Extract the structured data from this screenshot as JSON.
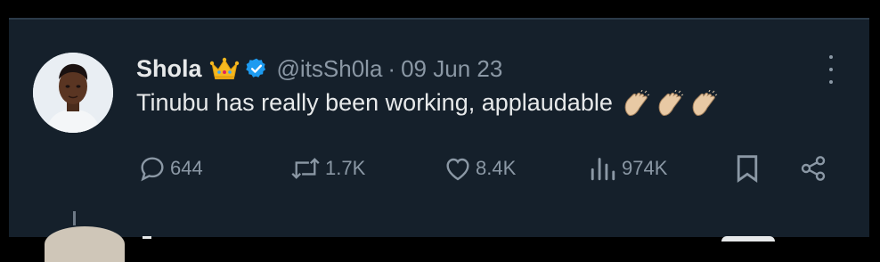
{
  "post": {
    "author_name": "Shola",
    "handle": "@itsSh0la",
    "separator": "·",
    "date": "09 Jun 23",
    "text": "Tinubu has really been working, applaudable"
  },
  "icons": {
    "crown": "crown-emoji",
    "verified": "verified-badge-icon",
    "claps": [
      "clapping-hands-emoji",
      "clapping-hands-emoji",
      "clapping-hands-emoji"
    ],
    "more": "more-options-icon"
  },
  "actions": {
    "replies": "644",
    "reposts": "1.7K",
    "likes": "8.4K",
    "views": "974K"
  },
  "colors": {
    "background": "#15202b",
    "text_primary": "#e7e9ea",
    "text_secondary": "#8b98a5",
    "verified": "#1d9bf0"
  }
}
